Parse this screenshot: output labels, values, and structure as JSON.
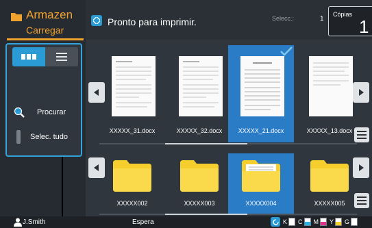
{
  "left": {
    "tab_title": "Armazen",
    "tab_subtitle": "Carregar",
    "view_modes": [
      {
        "name": "grid-view",
        "active": true
      },
      {
        "name": "list-view",
        "active": false
      }
    ],
    "search_label": "Procurar",
    "select_all_label": "Selec. tudo"
  },
  "header": {
    "status_icon": "sync-icon",
    "status_text": "Pronto para imprimir.",
    "selected_label": "Selecc.:",
    "selected_count": "1",
    "copies_label": "Cópias",
    "copies_value": "1"
  },
  "documents": [
    {
      "name": "XXXXX_31.docx",
      "selected": false
    },
    {
      "name": "XXXXX_32.docx",
      "selected": false
    },
    {
      "name": "XXXXX_21.docx",
      "selected": true
    },
    {
      "name": "XXXXX_13.docx",
      "selected": false
    }
  ],
  "folders": [
    {
      "name": "XXXXX002",
      "selected": false,
      "has_documents": false
    },
    {
      "name": "XXXXX003",
      "selected": false,
      "has_documents": false
    },
    {
      "name": "XXXXX004",
      "selected": true,
      "has_documents": true
    },
    {
      "name": "XXXXX005",
      "selected": false,
      "has_documents": false
    }
  ],
  "status_bar": {
    "user_name": "J.Smith",
    "status": "Espera",
    "inks": [
      {
        "letter": "K",
        "color": "#1a1a1a",
        "level": 0
      },
      {
        "letter": "C",
        "color": "#22b6e8",
        "level": 0.5
      },
      {
        "letter": "M",
        "color": "#e0328c",
        "level": 0.5
      },
      {
        "letter": "Y",
        "color": "#f5d22a",
        "level": 0.5
      },
      {
        "letter": "G",
        "color": "#9aa0a6",
        "level": 0
      }
    ]
  },
  "colors": {
    "accent": "#2b9bd6",
    "selection": "#2b7cc7",
    "tab_orange": "#f0a22e",
    "folder_yellow": "#f6cf2f"
  }
}
